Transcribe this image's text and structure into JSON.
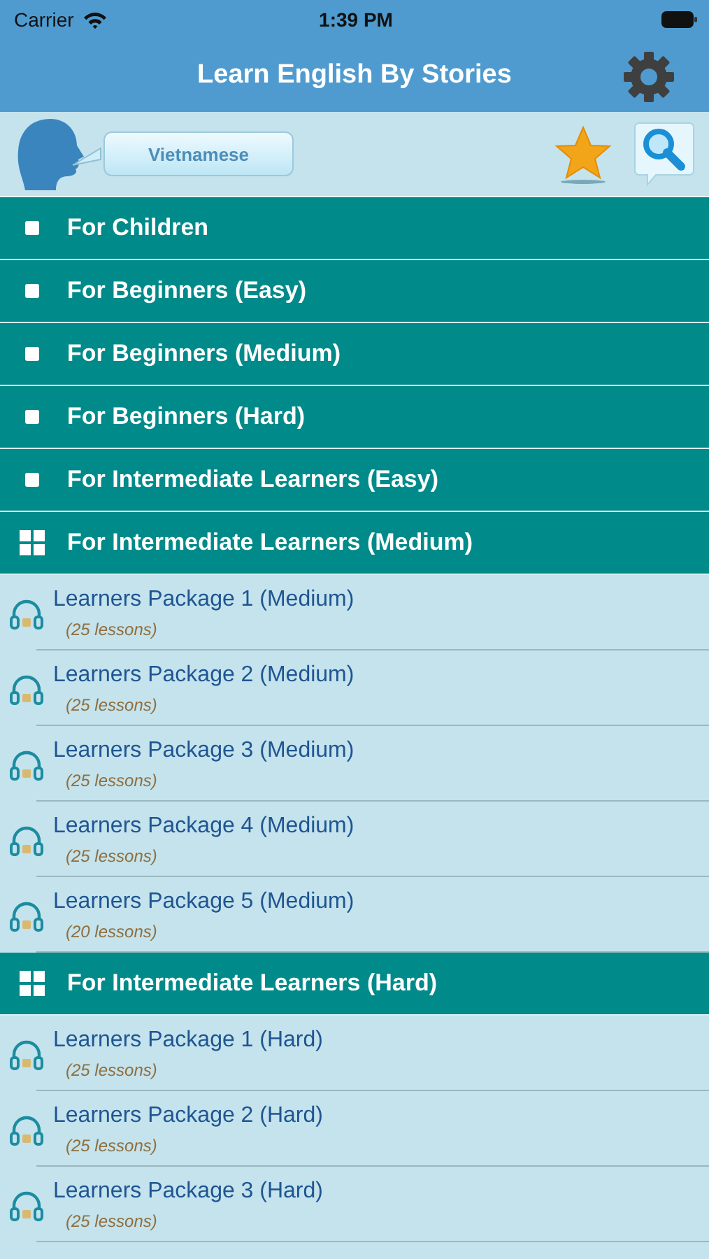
{
  "status_bar": {
    "carrier": "Carrier",
    "time": "1:39 PM"
  },
  "nav": {
    "title": "Learn English By Stories"
  },
  "toolbar": {
    "language": "Vietnamese"
  },
  "categories": [
    {
      "title": "For Children",
      "expanded": false
    },
    {
      "title": "For Beginners (Easy)",
      "expanded": false
    },
    {
      "title": "For Beginners (Medium)",
      "expanded": false
    },
    {
      "title": "For Beginners (Hard)",
      "expanded": false
    },
    {
      "title": "For Intermediate Learners (Easy)",
      "expanded": false
    },
    {
      "title": "For Intermediate Learners (Medium)",
      "expanded": true,
      "items": [
        {
          "title": "Learners Package 1 (Medium)",
          "lessons": "(25 lessons)"
        },
        {
          "title": "Learners Package 2 (Medium)",
          "lessons": "(25 lessons)"
        },
        {
          "title": "Learners Package 3 (Medium)",
          "lessons": "(25 lessons)"
        },
        {
          "title": "Learners Package 4 (Medium)",
          "lessons": "(25 lessons)"
        },
        {
          "title": "Learners Package 5 (Medium)",
          "lessons": "(20 lessons)"
        }
      ]
    },
    {
      "title": "For Intermediate Learners (Hard)",
      "expanded": true,
      "items": [
        {
          "title": "Learners Package 1 (Hard)",
          "lessons": "(25 lessons)"
        },
        {
          "title": "Learners Package 2 (Hard)",
          "lessons": "(25 lessons)"
        },
        {
          "title": "Learners Package 3 (Hard)",
          "lessons": "(25 lessons)"
        }
      ]
    }
  ]
}
